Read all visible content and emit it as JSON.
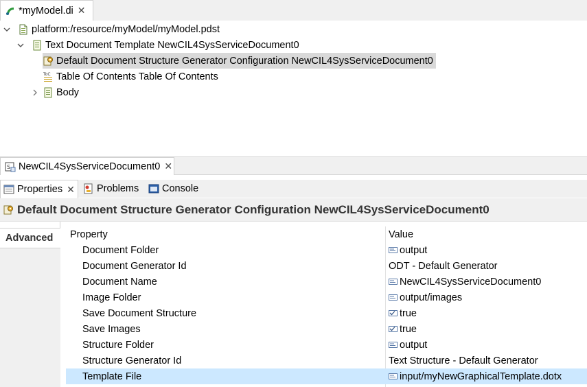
{
  "editor": {
    "tab_label": "*myModel.di",
    "close": "✕"
  },
  "tree": {
    "root": "platform:/resource/myModel/myModel.pdst",
    "template": "Text Document Template NewCIL4SysServiceDocument0",
    "children": [
      "Default Document Structure Generator Configuration NewCIL4SysServiceDocument0",
      "Table Of Contents Table Of Contents",
      "Body"
    ]
  },
  "doc_tab": {
    "label": "NewCIL4SysServiceDocument0",
    "close": "✕"
  },
  "views": {
    "tabs": [
      "Properties",
      "Problems",
      "Console"
    ],
    "close": "✕"
  },
  "properties": {
    "title": "Default Document Structure Generator Configuration NewCIL4SysServiceDocument0",
    "category": "Advanced",
    "header_property": "Property",
    "header_value": "Value",
    "rows": [
      {
        "key": "Document Folder",
        "value": "output",
        "icon": "text-field-icon"
      },
      {
        "key": "Document Generator Id",
        "value": "ODT - Default Generator",
        "icon": ""
      },
      {
        "key": "Document Name",
        "value": "NewCIL4SysServiceDocument0",
        "icon": "text-field-icon"
      },
      {
        "key": "Image Folder",
        "value": "output/images",
        "icon": "text-field-icon"
      },
      {
        "key": "Save Document Structure",
        "value": "true",
        "icon": "checkbox-field-icon"
      },
      {
        "key": "Save Images",
        "value": "true",
        "icon": "checkbox-field-icon"
      },
      {
        "key": "Structure Folder",
        "value": "output",
        "icon": "text-field-icon"
      },
      {
        "key": "Structure Generator Id",
        "value": "Text Structure - Default Generator",
        "icon": ""
      },
      {
        "key": "Template File",
        "value": "input/myNewGraphicalTemplate.dotx",
        "icon": "text-field-icon"
      }
    ]
  },
  "colors": {
    "selection": "#cce8ff",
    "tree_selection": "#d9d9d9",
    "panel_bg": "#f0f0f0"
  }
}
